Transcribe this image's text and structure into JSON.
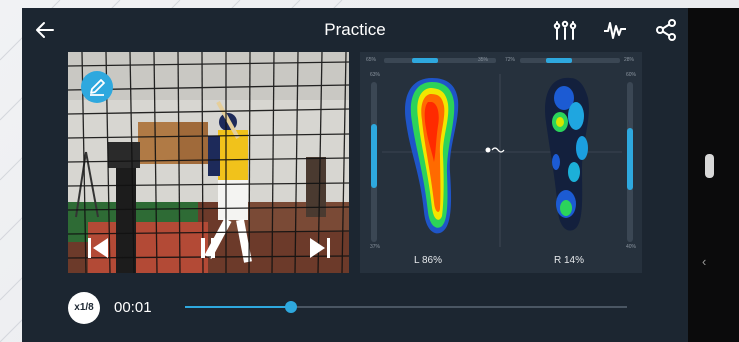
{
  "header": {
    "title": "Practice",
    "icons": [
      "back-arrow-icon",
      "sliders-icon",
      "waveform-icon",
      "share-icon"
    ]
  },
  "pressure": {
    "left_label": "L 86%",
    "right_label": "R 14%",
    "left_fraction": 0.86,
    "right_fraction": 0.14,
    "scale": {
      "left_top_outer": "65%",
      "left_top_inner": "35%",
      "right_top_inner": "72%",
      "right_top_outer": "28%",
      "left_side_top": "63%",
      "left_side_bottom": "37%",
      "right_side_top": "60%",
      "right_side_bottom": "40%"
    }
  },
  "timeline": {
    "speed_label": "x1/8",
    "time": "00:01",
    "progress": 0.24
  },
  "colors": {
    "accent": "#2ea8de",
    "panel": "#1c2631"
  }
}
